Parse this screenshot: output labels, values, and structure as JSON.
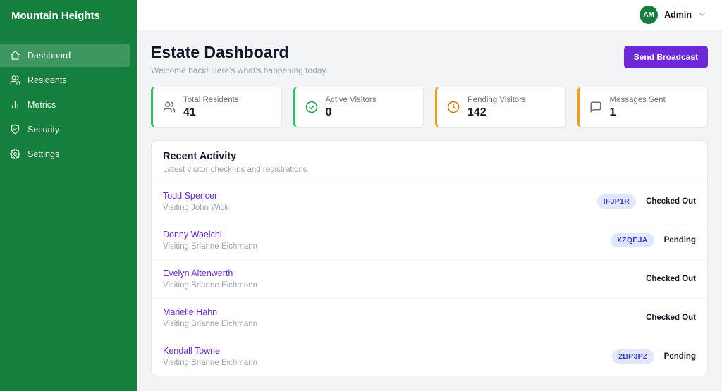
{
  "sidebar": {
    "title": "Mountain Heights",
    "items": [
      {
        "label": "Dashboard",
        "icon": "home-icon",
        "active": true
      },
      {
        "label": "Residents",
        "icon": "users-icon",
        "active": false
      },
      {
        "label": "Metrics",
        "icon": "bar-chart-icon",
        "active": false
      },
      {
        "label": "Security",
        "icon": "shield-icon",
        "active": false
      },
      {
        "label": "Settings",
        "icon": "gear-icon",
        "active": false
      }
    ]
  },
  "topbar": {
    "avatar_initials": "AM",
    "user_label": "Admin"
  },
  "page": {
    "title": "Estate Dashboard",
    "subtitle": "Welcome back! Here's what's happening today.",
    "broadcast_button": "Send Broadcast"
  },
  "colors": {
    "sidebar_green": "#15803d",
    "accent_purple": "#6d28d9",
    "stat_green": "#22c55e",
    "stat_amber": "#f59e0b",
    "badge_bg": "#e0e7ff",
    "badge_text": "#4338ca"
  },
  "stats": [
    {
      "label": "Total Residents",
      "value": "41",
      "accent": "#22c55e",
      "icon": "residents-icon"
    },
    {
      "label": "Active Visitors",
      "value": "0",
      "accent": "#22c55e",
      "icon": "check-circle-icon"
    },
    {
      "label": "Pending Visitors",
      "value": "142",
      "accent": "#f59e0b",
      "icon": "clock-icon"
    },
    {
      "label": "Messages Sent",
      "value": "1",
      "accent": "#f59e0b",
      "icon": "message-icon"
    }
  ],
  "activity": {
    "title": "Recent Activity",
    "subtitle": "Latest visitor check-ins and registrations",
    "rows": [
      {
        "name": "Todd Spencer",
        "detail": "Visiting John Wick",
        "code": "IFJP1R",
        "status": "Checked Out"
      },
      {
        "name": "Donny Waelchi",
        "detail": "Visiting Brianne Eichmann",
        "code": "XZQEJA",
        "status": "Pending"
      },
      {
        "name": "Evelyn Altenwerth",
        "detail": "Visiting Brianne Eichmann",
        "code": "",
        "status": "Checked Out"
      },
      {
        "name": "Marielle Hahn",
        "detail": "Visiting Brianne Eichmann",
        "code": "",
        "status": "Checked Out"
      },
      {
        "name": "Kendall Towne",
        "detail": "Visiting Brianne Eichmann",
        "code": "2BP3PZ",
        "status": "Pending"
      }
    ]
  }
}
